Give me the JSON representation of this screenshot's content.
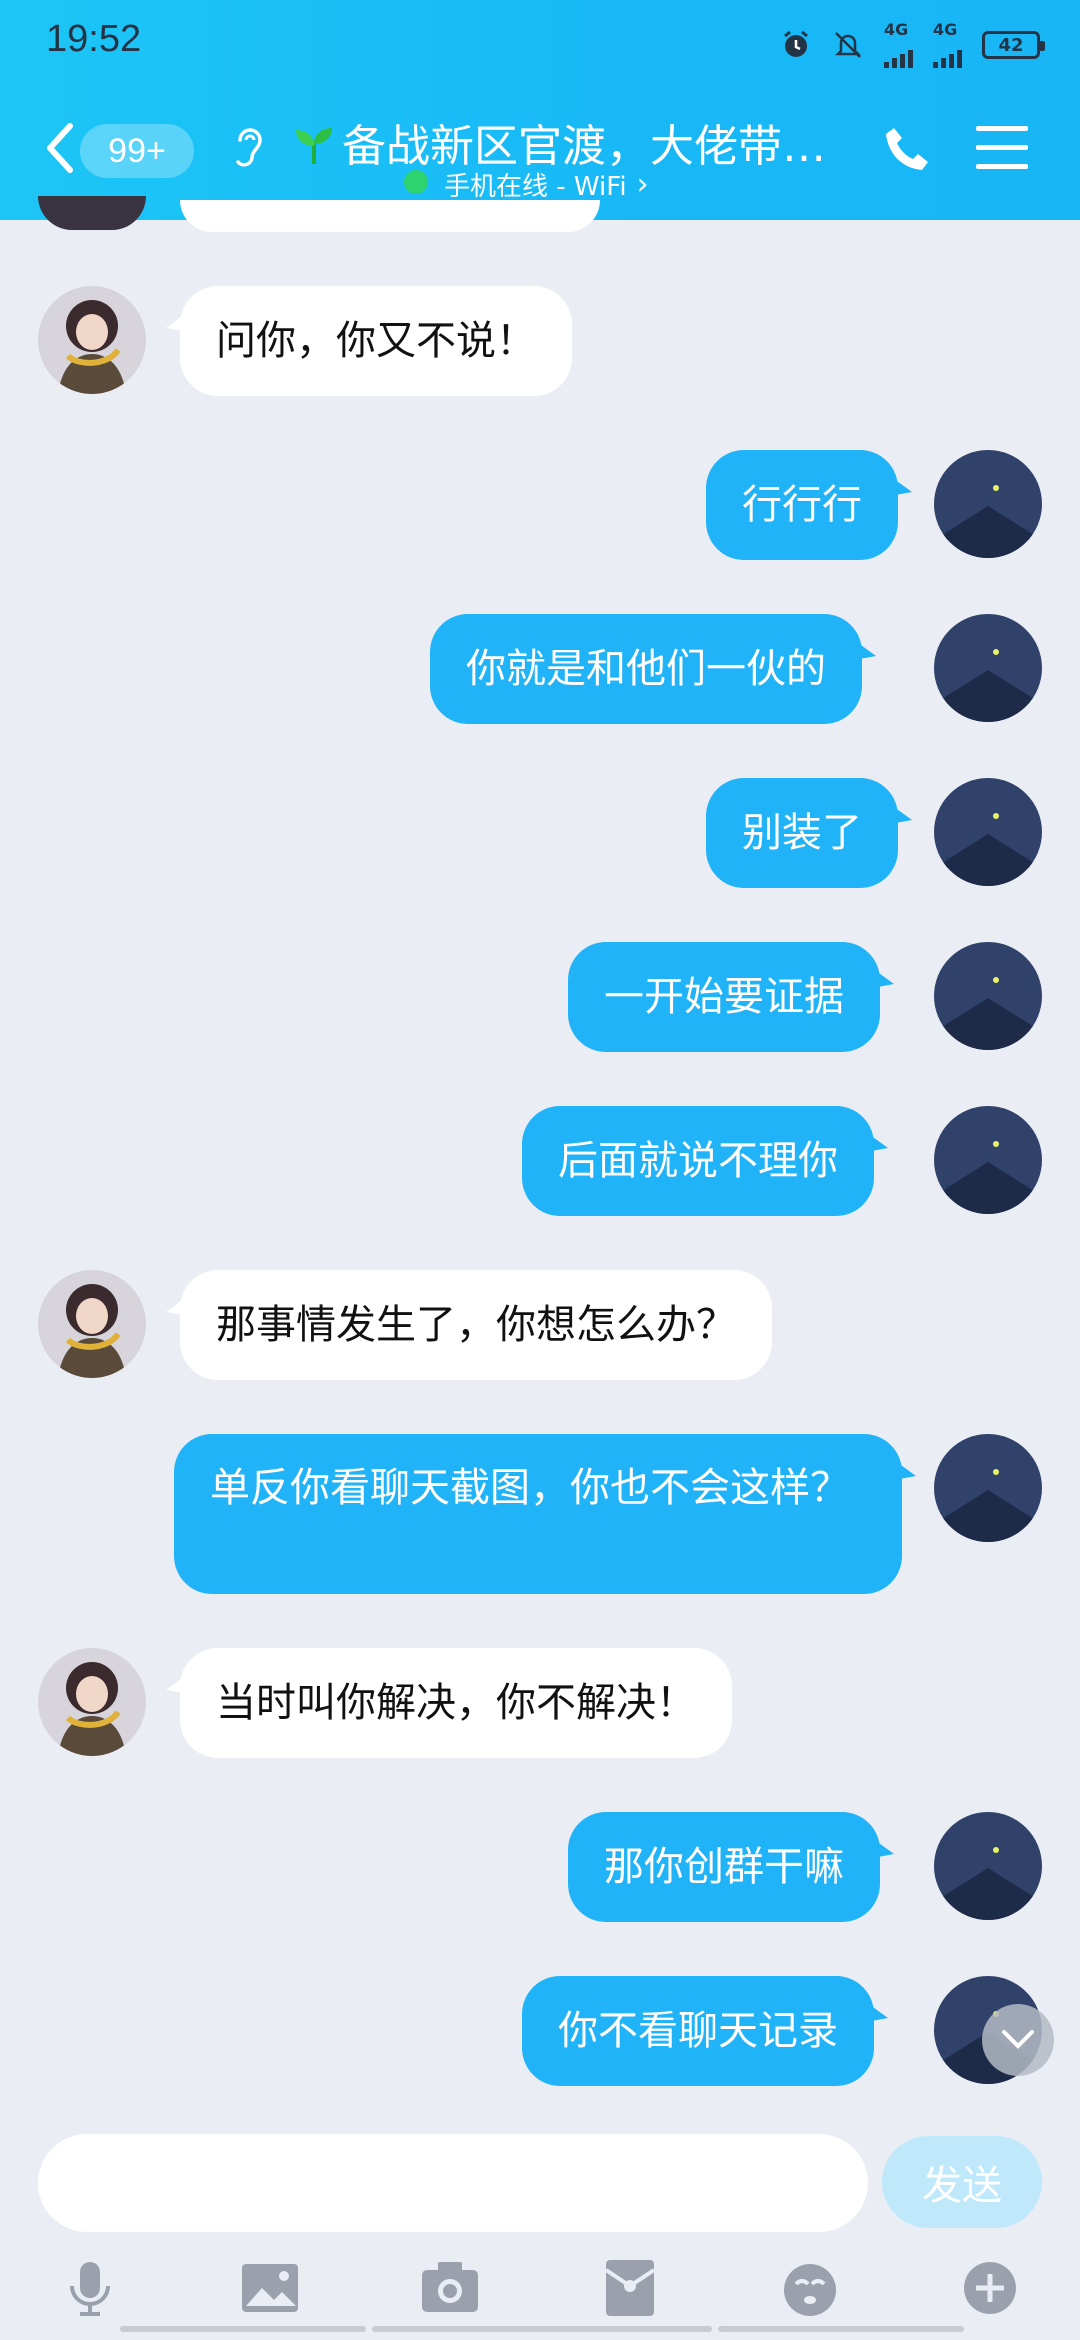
{
  "status_bar": {
    "time": "19:52",
    "net1": "4G",
    "net2": "4G",
    "battery": "42"
  },
  "header": {
    "unread_badge": "99+",
    "title": "备战新区官渡，大佬带…",
    "subtitle": "手机在线 - WiFi",
    "subtitle_chevron": "›"
  },
  "messages": [
    {
      "side": "in",
      "text": "问你，你又不说！"
    },
    {
      "side": "out",
      "text": "行行行"
    },
    {
      "side": "out",
      "text": "你就是和他们一伙的"
    },
    {
      "side": "out",
      "text": "别装了"
    },
    {
      "side": "out",
      "text": "一开始要证据"
    },
    {
      "side": "out",
      "text": "后面就说不理你"
    },
    {
      "side": "in",
      "text": "那事情发生了，你想怎么办？"
    },
    {
      "side": "out",
      "text": "单反你看聊天截图，你也不会这样？"
    },
    {
      "side": "in",
      "text": "当时叫你解决，你不解决！"
    },
    {
      "side": "out",
      "text": "那你创群干嘛"
    },
    {
      "side": "out",
      "text": "你不看聊天记录"
    }
  ],
  "composer": {
    "input_value": "",
    "send_label": "发送"
  },
  "toolbar": [
    "mic-icon",
    "image-icon",
    "camera-icon",
    "red-packet-icon",
    "emoji-icon",
    "plus-icon"
  ],
  "colors": {
    "header": "#19b9f6",
    "bubble_out": "#21b3f7",
    "bubble_in": "#ffffff",
    "background": "#eaedf4"
  }
}
